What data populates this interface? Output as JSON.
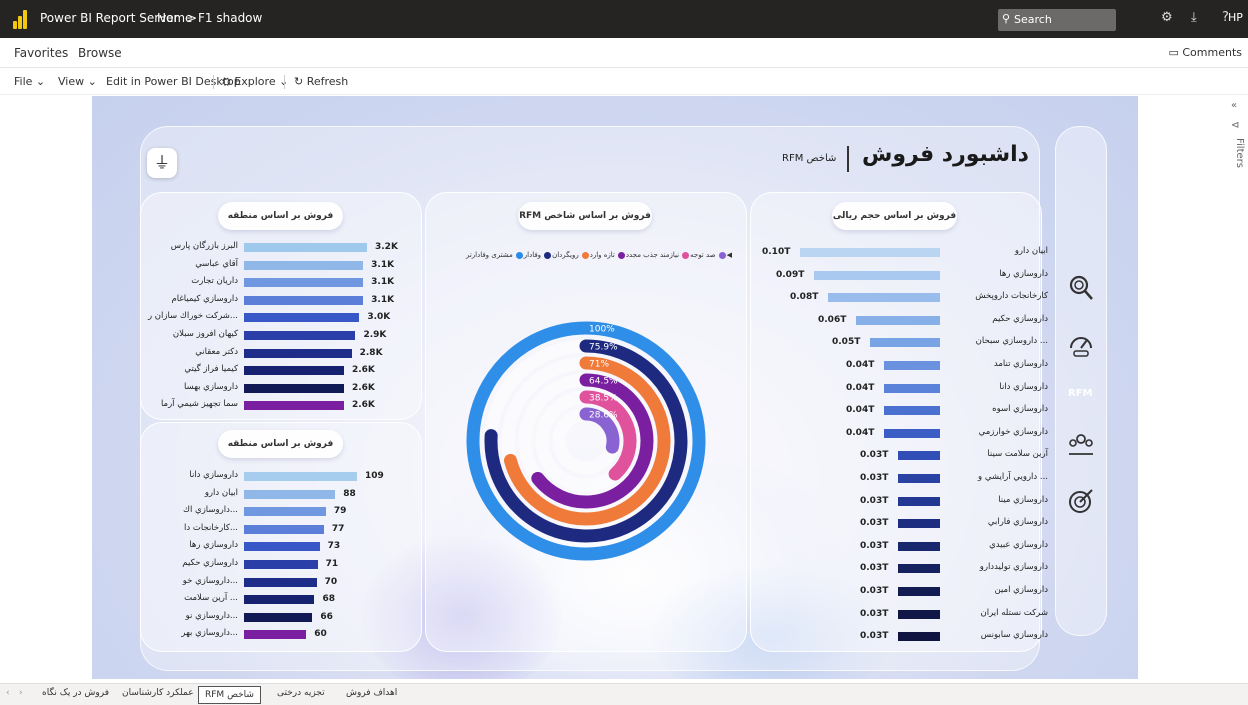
{
  "app": {
    "title": "Power BI Report Server",
    "breadcrumb_home": "Home",
    "breadcrumb_sep": ">",
    "breadcrumb_page": "F1 shadow",
    "search_placeholder": "Search",
    "search_icon": "⚲",
    "settings_icon": "⚙",
    "download_icon": "⤓",
    "help_icon": "?",
    "user": "HP"
  },
  "nav": {
    "favorites": "Favorites",
    "browse": "Browse",
    "comments": "Comments",
    "comments_icon": "▭"
  },
  "toolbar": {
    "file": "File ⌄",
    "view": "View ⌄",
    "edit": "Edit in Power BI Desktop",
    "explore": "Explore ⌄",
    "explore_icon": "⛭",
    "refresh": "Refresh",
    "refresh_icon": "↻"
  },
  "dashboard": {
    "title": "داشبورد فروش",
    "subtitle": "شاخص RFM",
    "plug_icon": "⏚",
    "left_top_title": "فروش بر اساس منطقه",
    "left_bottom_title": "فروش بر اساس منطقه",
    "center_title": "فروش بر اساس شاخص RFM",
    "right_title": "فروش بر اساس حجم ریالی",
    "rfm_tag": "RFM",
    "side_icons": [
      "money-search-icon",
      "dashboard-gauge-icon",
      "team-icon",
      "target-money-icon"
    ]
  },
  "region_sales": [
    {
      "label": "البرز بازرگان پارس",
      "value": "3.2K",
      "num": 3.2,
      "color": "#9fc9ec"
    },
    {
      "label": "آقاي عباسي",
      "value": "3.1K",
      "num": 3.1,
      "color": "#8fb8e8"
    },
    {
      "label": "داریان تجارت",
      "value": "3.1K",
      "num": 3.1,
      "color": "#6f98e0"
    },
    {
      "label": "داروسازي كيمياغام",
      "value": "3.1K",
      "num": 3.1,
      "color": "#5b7fd8"
    },
    {
      "label": "...شركت خوراك سازان ر",
      "value": "3.0K",
      "num": 3.0,
      "color": "#3858c8"
    },
    {
      "label": "كيهان افروز سبلان",
      "value": "2.9K",
      "num": 2.9,
      "color": "#2a40a8"
    },
    {
      "label": "دكتر معقاني",
      "value": "2.8K",
      "num": 2.8,
      "color": "#1e2d8a"
    },
    {
      "label": "كيميا فراز گيتي",
      "value": "2.6K",
      "num": 2.6,
      "color": "#162170"
    },
    {
      "label": "داروسازي بهسا",
      "value": "2.6K",
      "num": 2.6,
      "color": "#121a55"
    },
    {
      "label": "سما تجهيز شيمي آرما",
      "value": "2.6K",
      "num": 2.6,
      "color": "#7a1fa0"
    }
  ],
  "region_count": [
    {
      "label": "داروسازي دانا",
      "value": "109",
      "num": 109,
      "color": "#a6cdee"
    },
    {
      "label": "ابیان دارو",
      "value": "88",
      "num": 88,
      "color": "#8fb8e8"
    },
    {
      "label": "...داروسازي اك",
      "value": "79",
      "num": 79,
      "color": "#6f98e0"
    },
    {
      "label": "...كارخانجات دا",
      "value": "77",
      "num": 77,
      "color": "#5b7fd8"
    },
    {
      "label": "داروسازي رها",
      "value": "73",
      "num": 73,
      "color": "#3858c8"
    },
    {
      "label": "داروسازي حكيم",
      "value": "71",
      "num": 71,
      "color": "#2a40a8"
    },
    {
      "label": "...داروسازي خو",
      "value": "70",
      "num": 70,
      "color": "#1e2d8a"
    },
    {
      "label": "... آرين سلامت",
      "value": "68",
      "num": 68,
      "color": "#162170"
    },
    {
      "label": "...داروسازي نو",
      "value": "66",
      "num": 66,
      "color": "#121a55"
    },
    {
      "label": "...داروسازي بهر",
      "value": "60",
      "num": 60,
      "color": "#7a1fa0"
    }
  ],
  "rial_sales": [
    {
      "label": "ابیان دارو",
      "value": "0.10T",
      "num": 0.1,
      "color": "#b9d5f2"
    },
    {
      "label": "داروسازي رها",
      "value": "0.09T",
      "num": 0.09,
      "color": "#a9c9f0"
    },
    {
      "label": "كارخانجات داروپخش",
      "value": "0.08T",
      "num": 0.08,
      "color": "#98bdec"
    },
    {
      "label": "داروسازي حكيم",
      "value": "0.06T",
      "num": 0.06,
      "color": "#88b0e8"
    },
    {
      "label": "... داروسازي سبحان",
      "value": "0.05T",
      "num": 0.05,
      "color": "#78a3e4"
    },
    {
      "label": "داروسازي تنامد",
      "value": "0.04T",
      "num": 0.04,
      "color": "#6a92de"
    },
    {
      "label": "داروسازي دانا",
      "value": "0.04T",
      "num": 0.04,
      "color": "#5a82d8"
    },
    {
      "label": "داروسازي اسوه",
      "value": "0.04T",
      "num": 0.04,
      "color": "#4a70d0"
    },
    {
      "label": "داروسازي خوارزمي",
      "value": "0.04T",
      "num": 0.04,
      "color": "#3c5ec4"
    },
    {
      "label": "آرين سلامت سينا",
      "value": "0.03T",
      "num": 0.03,
      "color": "#304eb6"
    },
    {
      "label": "... دارويي آرايشي و",
      "value": "0.03T",
      "num": 0.03,
      "color": "#2942a4"
    },
    {
      "label": "داروسازي مينا",
      "value": "0.03T",
      "num": 0.03,
      "color": "#233892"
    },
    {
      "label": "داروسازي فارابي",
      "value": "0.03T",
      "num": 0.03,
      "color": "#1d2e80"
    },
    {
      "label": "داروسازي عبيدي",
      "value": "0.03T",
      "num": 0.03,
      "color": "#19276e"
    },
    {
      "label": "داروسازي توليددارو",
      "value": "0.03T",
      "num": 0.03,
      "color": "#16215f"
    },
    {
      "label": "داروسازي امين",
      "value": "0.03T",
      "num": 0.03,
      "color": "#131c52"
    },
    {
      "label": "شركت نستله ايران",
      "value": "0.03T",
      "num": 0.03,
      "color": "#111848"
    },
    {
      "label": "داروسازي سابونس",
      "value": "0.03T",
      "num": 0.03,
      "color": "#0f1540"
    }
  ],
  "rfm_legend": [
    {
      "label": "صد توجه",
      "color": "#8a63d2"
    },
    {
      "label": "نیازمند جذب مجدد",
      "color": "#e0529c"
    },
    {
      "label": "تازه وارد",
      "color": "#7a1fa0"
    },
    {
      "label": "رویگردان",
      "color": "#f07a3a"
    },
    {
      "label": "وفادار",
      "color": "#1e2a80"
    },
    {
      "label": "مشتری وفادارتر",
      "color": "#2a8ae8"
    }
  ],
  "legend_arrow": "◀",
  "chart_data": {
    "type": "radial-bar",
    "title": "فروش بر اساس شاخص RFM",
    "series": [
      {
        "name": "مشتری وفادارتر",
        "percent": 100,
        "label": "100%",
        "color": "#2f8fe8"
      },
      {
        "name": "وفادار",
        "percent": 75.9,
        "label": "75.9%",
        "color": "#1e2a80"
      },
      {
        "name": "رویگردان",
        "percent": 71,
        "label": "71%",
        "color": "#f07a3a"
      },
      {
        "name": "تازه وارد",
        "percent": 64.5,
        "label": "64.5%",
        "color": "#7a1fa0"
      },
      {
        "name": "نیازمند جذب مجدد",
        "percent": 38.5,
        "label": "38.5%",
        "color": "#e0529c"
      },
      {
        "name": "صد توجه",
        "percent": 28.6,
        "label": "28.6%",
        "color": "#8a63d2"
      }
    ]
  },
  "filters": {
    "label": "Filters",
    "collapse_icon": "«",
    "filter_icon": "⊲"
  },
  "tabs": [
    {
      "label": "فروش در یک نگاه",
      "active": false
    },
    {
      "label": "عملکرد کارشناسان",
      "active": false
    },
    {
      "label": "شاخص RFM",
      "active": true
    },
    {
      "label": "تجزیه درختی",
      "active": false
    },
    {
      "label": "اهداف فروش",
      "active": false
    }
  ],
  "tab_nav": {
    "prev": "‹",
    "next": "›"
  }
}
